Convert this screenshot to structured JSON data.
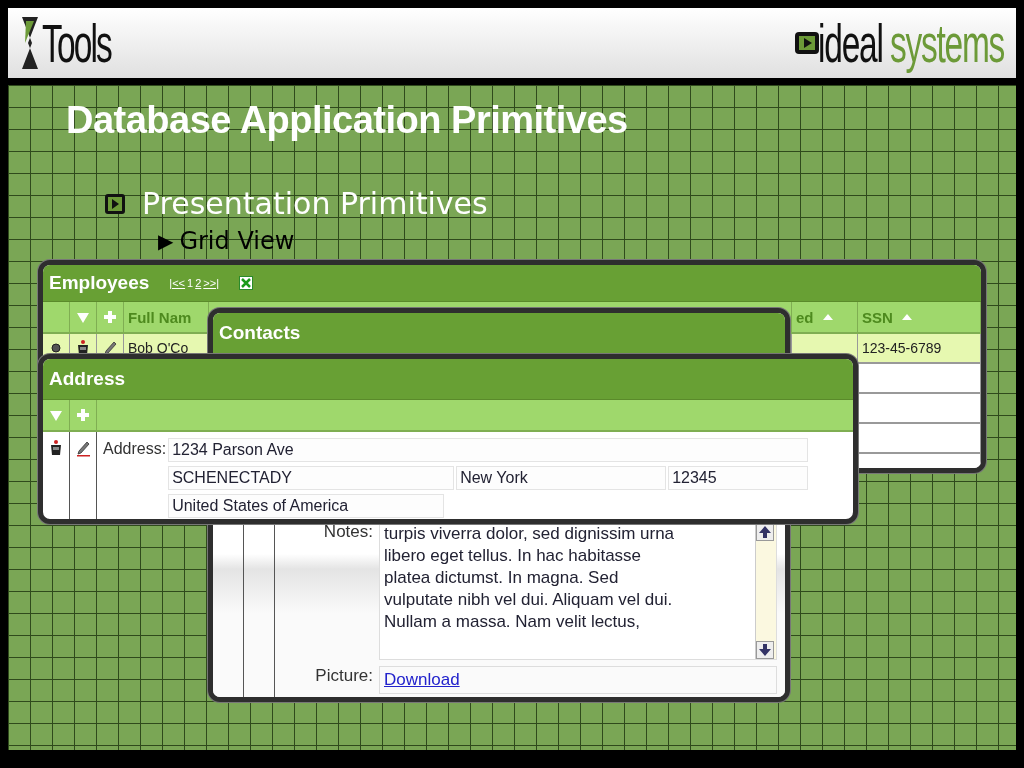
{
  "header": {
    "product_logo": "Tools",
    "company_logo": {
      "word_1": "ideal",
      "word_2": "systems"
    }
  },
  "slide": {
    "title": "Database Application Primitives",
    "bullets": [
      {
        "text": "Presentation Primitives",
        "children": [
          {
            "marker": "▶",
            "text": "Grid View"
          }
        ]
      }
    ]
  },
  "employees_grid": {
    "title": "Employees",
    "pager": {
      "first": "|<<",
      "pages": [
        {
          "label": "1",
          "selected": true
        },
        {
          "label": "2",
          "selected": false
        }
      ],
      "last": ">>|"
    },
    "columns": [
      {
        "label": "Full Nam",
        "sorted": false
      },
      {
        "label": "ed",
        "sorted": true
      },
      {
        "label": "SSN",
        "sorted": true
      }
    ],
    "rows": [
      {
        "full_name": "Bob O'Co",
        "ssn": "123-45-6789",
        "selected": true
      },
      {
        "selected": false
      },
      {
        "selected": false
      },
      {
        "selected": false
      },
      {
        "selected": false
      }
    ]
  },
  "contacts": {
    "title": "Contacts",
    "notes_label": "Notes:",
    "notes_lines": [
      "turpis viverra dolor, sed dignissim urna",
      "libero eget tellus. In hac habitasse",
      "platea dictumst. In magna. Sed",
      "vulputate nibh vel dui. Aliquam vel dui.",
      "Nullam a massa. Nam velit lectus,"
    ],
    "picture_label": "Picture:",
    "picture_link": "Download"
  },
  "address": {
    "title": "Address",
    "label": "Address:",
    "street": "1234 Parson Ave",
    "city": "SCHENECTADY",
    "state": "New York",
    "zip": "12345",
    "country": "United States of America"
  }
}
